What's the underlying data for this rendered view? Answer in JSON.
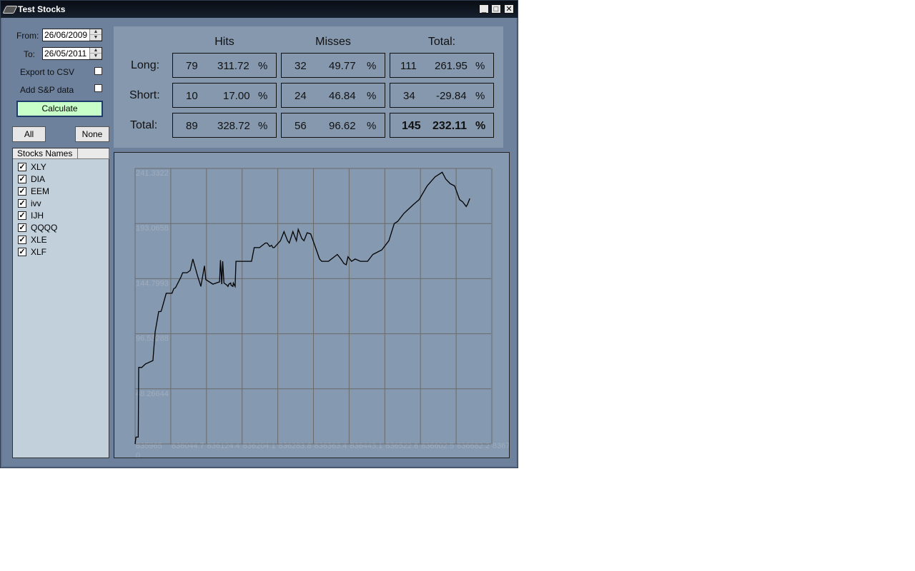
{
  "window": {
    "title": "Test Stocks"
  },
  "controls": {
    "from_label": "From:",
    "from_value": "26/06/2009",
    "to_label": "To:",
    "to_value": "26/05/2011",
    "export_label": "Export to CSV",
    "sp_label": "Add S&P data",
    "calculate_label": "Calculate",
    "all_label": "All",
    "none_label": "None"
  },
  "stocks": {
    "header": "Stocks Names",
    "items": [
      "XLY",
      "DIA",
      "EEM",
      "ivv",
      "IJH",
      "QQQQ",
      "XLE",
      "XLF"
    ]
  },
  "stats": {
    "headers": {
      "hits": "Hits",
      "misses": "Misses",
      "total": "Total:"
    },
    "rows": {
      "long": {
        "label": "Long:",
        "hits_n": "79",
        "hits_pct": "311.72",
        "misses_n": "32",
        "misses_pct": "49.77",
        "total_n": "111",
        "total_pct": "261.95"
      },
      "short": {
        "label": "Short:",
        "hits_n": "10",
        "hits_pct": "17.00",
        "misses_n": "24",
        "misses_pct": "46.84",
        "total_n": "34",
        "total_pct": "-29.84"
      },
      "total": {
        "label": "Total:",
        "hits_n": "89",
        "hits_pct": "328.72",
        "misses_n": "56",
        "misses_pct": "96.62",
        "total_n": "145",
        "total_pct": "232.11"
      }
    },
    "pct_symbol": "%"
  },
  "chart_data": {
    "type": "line",
    "title": "",
    "xlabel": "",
    "ylabel": "",
    "grid": true,
    "x_ticks": [
      "835965",
      "836044.7",
      "836124.4",
      "836204.1",
      "836283.8",
      "836363.4",
      "836443.1",
      "836522.8",
      "836602.5",
      "836682.2",
      "83676"
    ],
    "x_tick_extra": "0",
    "y_ticks": [
      "241.3322",
      "193.0658",
      "144.7993",
      "96.53288",
      "48.26644"
    ],
    "ylim": [
      0,
      241.3322
    ],
    "xlim": [
      835965,
      836762
    ],
    "line_color": "#000000",
    "series": [
      {
        "x": [
          835965,
          835967,
          835972,
          835973,
          835980,
          835988,
          836005,
          836010,
          836018,
          836023,
          836025,
          836035,
          836040,
          836048,
          836052,
          836056,
          836068,
          836072,
          836078,
          836082,
          836089,
          836095,
          836105,
          836113,
          836121,
          836124,
          836140,
          836155,
          836157,
          836160,
          836162,
          836165,
          836172,
          836174,
          836176,
          836180,
          836181,
          836185,
          836186,
          836190,
          836192,
          836196,
          836212,
          836227,
          836233,
          836245,
          836258,
          836262,
          836268,
          836272,
          836275,
          836278,
          836292,
          836300,
          836308,
          836312,
          836320,
          836328,
          836332,
          836340,
          836345,
          836352,
          836360,
          836372,
          836380,
          836385,
          836392,
          836400,
          836420,
          836428,
          836435,
          836440,
          836444,
          836452,
          836460,
          836472,
          836480,
          836488,
          836492,
          836500,
          836520,
          836536,
          836548,
          836556,
          836570,
          836592,
          836604,
          836622,
          836640,
          836656,
          836664,
          836674,
          836684,
          836695,
          836702,
          836710,
          836713,
          836718
        ],
        "y": [
          0,
          6,
          6,
          67,
          67,
          70,
          73,
          98,
          116,
          116,
          118,
          132,
          132,
          132,
          136,
          137,
          146,
          150,
          150,
          150,
          152,
          162,
          148,
          138,
          156,
          144,
          140,
          142,
          161,
          140,
          160,
          141,
          139,
          138,
          140,
          141,
          139,
          138,
          141,
          138,
          160,
          160,
          160,
          160,
          172,
          172,
          176,
          176,
          173,
          174,
          172,
          172,
          178,
          186,
          178,
          176,
          186,
          178,
          188,
          180,
          178,
          185,
          184,
          171,
          162,
          160,
          160,
          160,
          166,
          162,
          158,
          157,
          164,
          160,
          162,
          160,
          160,
          160,
          162,
          166,
          170,
          178,
          193,
          195,
          202,
          210,
          214,
          226,
          234,
          238,
          232,
          228,
          226,
          214,
          212,
          208,
          210,
          215
        ]
      }
    ]
  }
}
